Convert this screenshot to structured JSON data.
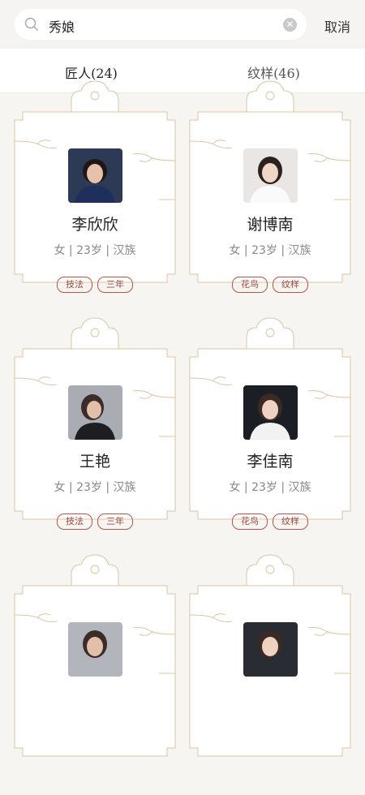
{
  "search": {
    "query": "秀娘",
    "cancel_label": "取消"
  },
  "tabs": [
    {
      "label": "匠人(24)",
      "active": true
    },
    {
      "label": "纹样(46)",
      "active": false
    }
  ],
  "colors": {
    "accent": "#b0564a",
    "frame_line": "#dcc4a6"
  },
  "cards": [
    {
      "name": "李欣欣",
      "meta": "女 | 23岁 | 汉族",
      "tags": [
        "技法",
        "三年"
      ]
    },
    {
      "name": "谢博南",
      "meta": "女 | 23岁 | 汉族",
      "tags": [
        "花鸟",
        "纹样"
      ]
    },
    {
      "name": "王艳",
      "meta": "女 | 23岁 | 汉族",
      "tags": [
        "技法",
        "三年"
      ]
    },
    {
      "name": "李佳南",
      "meta": "女 | 23岁 | 汉族",
      "tags": [
        "花鸟",
        "纹样"
      ]
    },
    {
      "name": "",
      "meta": "",
      "tags": []
    },
    {
      "name": "",
      "meta": "",
      "tags": []
    }
  ]
}
